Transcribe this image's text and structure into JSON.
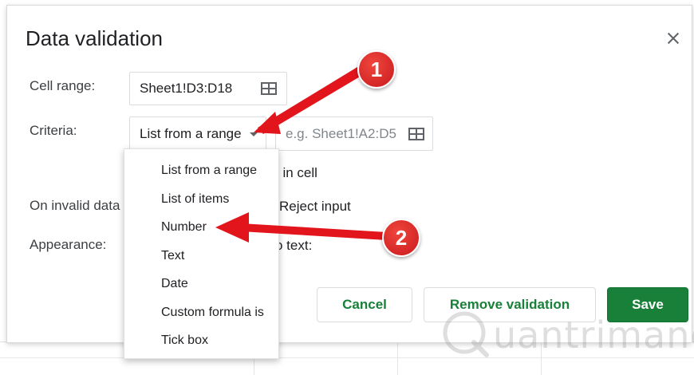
{
  "dialog": {
    "title": "Data validation",
    "close_icon": "close-icon"
  },
  "cell_range": {
    "label": "Cell range:",
    "value": "Sheet1!D3:D18",
    "icon": "grid-icon"
  },
  "criteria": {
    "label": "Criteria:",
    "selected": "List from a range",
    "range_placeholder": "e.g. Sheet1!A2:D5",
    "icon": "grid-icon"
  },
  "criteria_menu": {
    "items": [
      "List from a range",
      "List of items",
      "Number",
      "Text",
      "Date",
      "Custom formula is",
      "Tick box"
    ]
  },
  "obscured": {
    "show_list_partial": "t in cell",
    "invalid_label": "On invalid data",
    "reject_partial": "Reject input",
    "appearance_label": "Appearance:",
    "help_partial": "o text:"
  },
  "buttons": {
    "cancel": "Cancel",
    "remove": "Remove validation",
    "save": "Save"
  },
  "annotations": {
    "badge_1": "1",
    "badge_2": "2",
    "arrow_color": "#e3151c"
  },
  "watermark": {
    "text": "uantrimang"
  }
}
